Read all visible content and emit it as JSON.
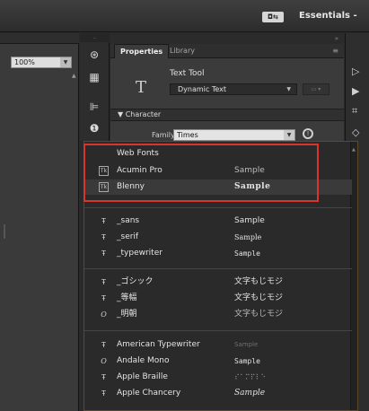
{
  "topbar": {
    "workspace_label": "Essentials -",
    "workspace_switch": "◘⇆"
  },
  "stage": {
    "zoom_value": "100%"
  },
  "tools": {
    "icons": [
      "transform-3d-icon",
      "grid-icon",
      "align-icon",
      "info-icon"
    ]
  },
  "properties": {
    "tab_properties": "Properties",
    "tab_library": "Library",
    "tool_glyph": "T",
    "tool_name": "Text Tool",
    "text_type": "Dynamic Text",
    "section_character": "Character",
    "family_label": "Family:",
    "family_value": "Times"
  },
  "font_menu": {
    "web_fonts_title": "Web Fonts",
    "web_fonts": [
      {
        "name": "Acumin Pro",
        "sample": "Sample",
        "icon": "Tk"
      },
      {
        "name": "Blenny",
        "sample": "Sample",
        "icon": "Tk"
      }
    ],
    "generic_fonts": [
      {
        "name": "_sans",
        "sample": "Sample"
      },
      {
        "name": "_serif",
        "sample": "Sample"
      },
      {
        "name": "_typewriter",
        "sample": "Sample"
      }
    ],
    "japanese_fonts": [
      {
        "name": "_ゴシック",
        "sample": "文字もじモジ"
      },
      {
        "name": "_等幅",
        "sample": "文字もじモジ"
      },
      {
        "name": "_明朝",
        "sample": "文字もじモジ"
      }
    ],
    "system_fonts": [
      {
        "name": "American Typewriter",
        "sample": "Sample"
      },
      {
        "name": "Andale Mono",
        "sample": "Sample"
      },
      {
        "name": "Apple Braille",
        "sample": "⠎⠁⠍⠏⠇⠑"
      },
      {
        "name": "Apple Chancery",
        "sample": "Sample"
      }
    ]
  },
  "colors": {
    "highlight": "#d8362c",
    "panel": "#3b3b3b",
    "dropdown": "#2a2a2a"
  }
}
